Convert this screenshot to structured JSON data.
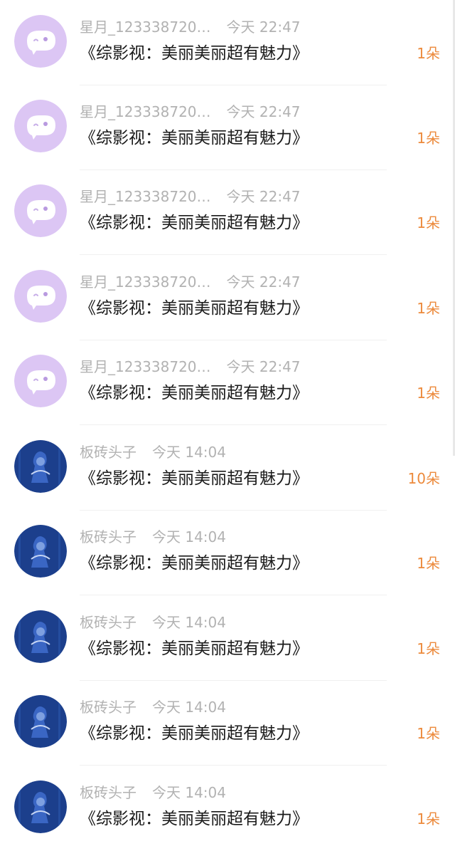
{
  "messages": [
    {
      "sender": "星月_123338720…",
      "time": "今天 22:47",
      "title": "《综影视：美丽美丽超有魅力》",
      "count": "1朵",
      "avatar": "ghost-avatar-icon"
    },
    {
      "sender": "星月_123338720…",
      "time": "今天 22:47",
      "title": "《综影视：美丽美丽超有魅力》",
      "count": "1朵",
      "avatar": "ghost-avatar-icon"
    },
    {
      "sender": "星月_123338720…",
      "time": "今天 22:47",
      "title": "《综影视：美丽美丽超有魅力》",
      "count": "1朵",
      "avatar": "ghost-avatar-icon"
    },
    {
      "sender": "星月_123338720…",
      "time": "今天 22:47",
      "title": "《综影视：美丽美丽超有魅力》",
      "count": "1朵",
      "avatar": "ghost-avatar-icon"
    },
    {
      "sender": "星月_123338720…",
      "time": "今天 22:47",
      "title": "《综影视：美丽美丽超有魅力》",
      "count": "1朵",
      "avatar": "ghost-avatar-icon"
    },
    {
      "sender": "板砖头子",
      "time": "今天 14:04",
      "title": "《综影视：美丽美丽超有魅力》",
      "count": "10朵",
      "avatar": "blue-photo-avatar"
    },
    {
      "sender": "板砖头子",
      "time": "今天 14:04",
      "title": "《综影视：美丽美丽超有魅力》",
      "count": "1朵",
      "avatar": "blue-photo-avatar"
    },
    {
      "sender": "板砖头子",
      "time": "今天 14:04",
      "title": "《综影视：美丽美丽超有魅力》",
      "count": "1朵",
      "avatar": "blue-photo-avatar"
    },
    {
      "sender": "板砖头子",
      "time": "今天 14:04",
      "title": "《综影视：美丽美丽超有魅力》",
      "count": "1朵",
      "avatar": "blue-photo-avatar"
    },
    {
      "sender": "板砖头子",
      "time": "今天 14:04",
      "title": "《综影视：美丽美丽超有魅力》",
      "count": "1朵",
      "avatar": "blue-photo-avatar"
    }
  ],
  "colors": {
    "ghost_avatar_bg": "#dcc6f4",
    "photo_avatar_bg": "#1c3f8c",
    "count_text": "#ec8a3c",
    "meta_text": "#b2b2b2",
    "title_text": "#1a1a1a"
  }
}
